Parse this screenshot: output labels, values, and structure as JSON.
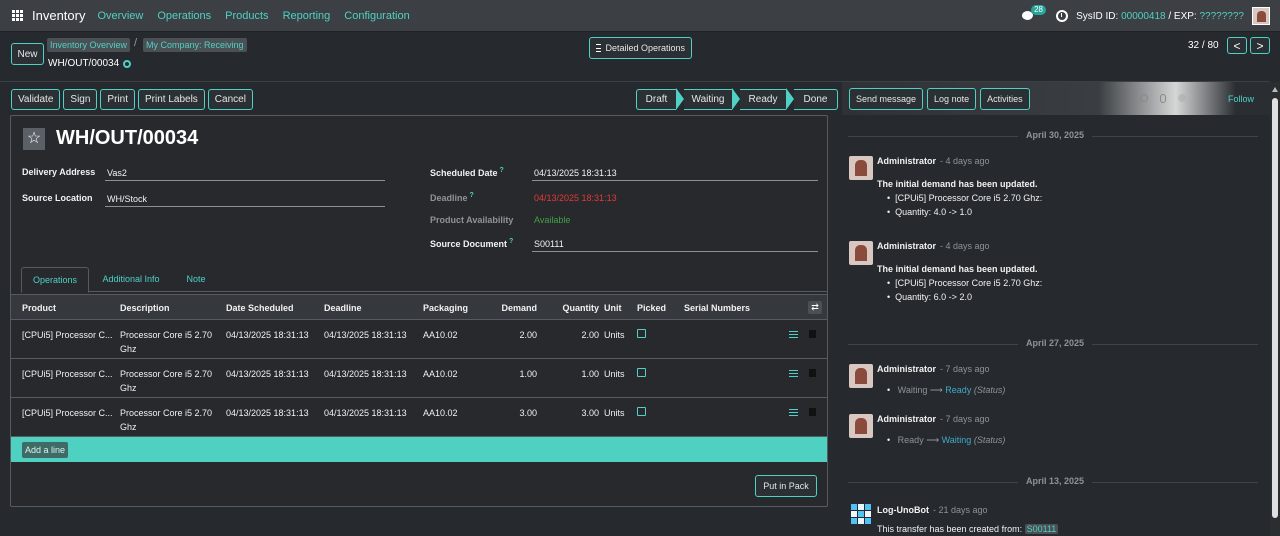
{
  "navbar": {
    "app_name": "Inventory",
    "menu": [
      "Overview",
      "Operations",
      "Products",
      "Reporting",
      "Configuration"
    ],
    "chat_count": "28",
    "sysid_label": "SysID",
    "id_label": "ID:",
    "id_value": "00000418",
    "exp_label": "/ EXP:",
    "exp_value": "????????"
  },
  "control": {
    "new_label": "New",
    "breadcrumb": [
      "Inventory Overview",
      "My Company: Receiving"
    ],
    "breadcrumb_sep": "/",
    "record_name": "WH/OUT/00034",
    "detailed_ops_label": "Detailed Operations",
    "pager": "32 / 80",
    "prev": "<",
    "next": ">"
  },
  "actions": [
    "Validate",
    "Sign",
    "Print",
    "Print Labels",
    "Cancel"
  ],
  "statusbar": {
    "stages": [
      "Draft",
      "Waiting",
      "Ready",
      "Done"
    ]
  },
  "form": {
    "star": "☆",
    "title": "WH/OUT/00034",
    "delivery_address_label": "Delivery Address",
    "delivery_address": "Vas2",
    "source_location_label": "Source Location",
    "source_location": "WH/Stock",
    "scheduled_date_label": "Scheduled Date",
    "scheduled_date": "04/13/2025 18:31:13",
    "deadline_label": "Deadline",
    "deadline": "04/13/2025 18:31:13",
    "availability_label": "Product Availability",
    "availability": "Available",
    "source_document_label": "Source Document",
    "source_document": "S00111",
    "help_mark": "?"
  },
  "tabs": [
    "Operations",
    "Additional Info",
    "Note"
  ],
  "table": {
    "columns": [
      "Product",
      "Description",
      "Date Scheduled",
      "Deadline",
      "Packaging",
      "Demand",
      "Quantity",
      "Unit",
      "Picked",
      "Serial Numbers"
    ],
    "rows": [
      {
        "product": "[CPUi5] Processor C...",
        "description": "Processor Core i5 2.70 Ghz",
        "date_scheduled": "04/13/2025 18:31:13",
        "deadline": "04/13/2025 18:31:13",
        "packaging": "AA10.02",
        "demand": "2.00",
        "quantity": "2.00",
        "unit": "Units"
      },
      {
        "product": "[CPUi5] Processor C...",
        "description": "Processor Core i5 2.70 Ghz",
        "date_scheduled": "04/13/2025 18:31:13",
        "deadline": "04/13/2025 18:31:13",
        "packaging": "AA10.02",
        "demand": "1.00",
        "quantity": "1.00",
        "unit": "Units"
      },
      {
        "product": "[CPUi5] Processor C...",
        "description": "Processor Core i5 2.70 Ghz",
        "date_scheduled": "04/13/2025 18:31:13",
        "deadline": "04/13/2025 18:31:13",
        "packaging": "AA10.02",
        "demand": "3.00",
        "quantity": "3.00",
        "unit": "Units"
      }
    ],
    "add_line_label": "Add a line",
    "optional_columns_icon": "⇄",
    "put_in_pack_label": "Put in Pack"
  },
  "chatter": {
    "send_message_label": "Send message",
    "log_note_label": "Log note",
    "activities_label": "Activities",
    "follow_label": "Follow",
    "dates": [
      "April 30, 2025",
      "April 27, 2025",
      "April 13, 2025"
    ],
    "messages": [
      {
        "author": "Administrator",
        "when": "- 4 days ago",
        "text": "The initial demand has been updated.",
        "bullets": [
          "[CPUi5] Processor Core i5 2.70 Ghz:",
          "Quantity: 4.0 -> 1.0"
        ]
      },
      {
        "author": "Administrator",
        "when": "- 4 days ago",
        "text": "The initial demand has been updated.",
        "bullets": [
          "[CPUi5] Processor Core i5 2.70 Ghz:",
          "Quantity: 6.0 -> 2.0"
        ]
      },
      {
        "author": "Administrator",
        "when": "- 7 days ago",
        "from": "Waiting",
        "arrow": "⟶",
        "to": "Ready",
        "field": "(Status)"
      },
      {
        "author": "Administrator",
        "when": "- 7 days ago",
        "from": "Ready",
        "arrow": "⟶",
        "to": "Waiting",
        "field": "(Status)"
      },
      {
        "author": "Log-UnoBot",
        "when": "- 21 days ago",
        "text": "This transfer has been created from:",
        "link": "S00111"
      }
    ]
  },
  "colors": {
    "accent": "#4fd1c5",
    "danger": "#e53935",
    "success": "#43a047",
    "background": "#262a2e"
  }
}
